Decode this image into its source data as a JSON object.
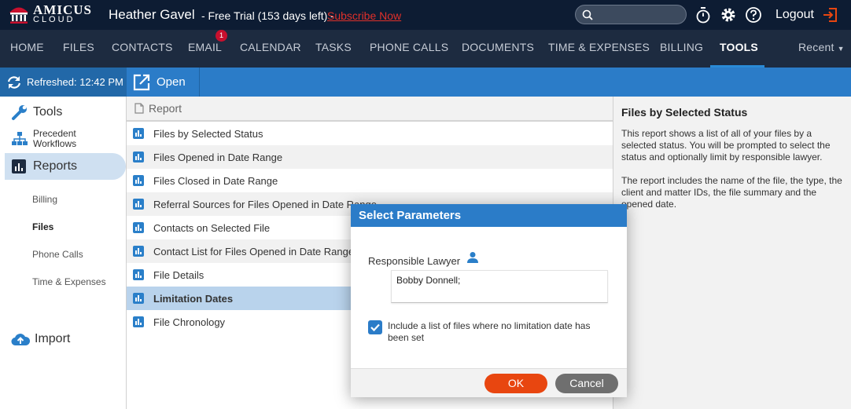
{
  "app": {
    "logo_line1": "AMICUS",
    "logo_line2": "CLOUD"
  },
  "header": {
    "user_name": "Heather Gavel",
    "trial": "- Free Trial (153 days left) -",
    "subscribe": "Subscribe Now",
    "logout": "Logout"
  },
  "nav": {
    "items": [
      "HOME",
      "FILES",
      "CONTACTS",
      "EMAIL",
      "CALENDAR",
      "TASKS",
      "PHONE CALLS",
      "DOCUMENTS",
      "TIME & EXPENSES",
      "BILLING",
      "TOOLS"
    ],
    "active": "TOOLS",
    "email_badge": "1",
    "recent": "Recent"
  },
  "toolbar": {
    "refreshed": "Refreshed: 12:42 PM",
    "open": "Open"
  },
  "sidebar": {
    "tools": "Tools",
    "workflows_line1": "Precedent",
    "workflows_line2": "Workflows",
    "reports": "Reports",
    "subs": [
      "Billing",
      "Files",
      "Phone Calls",
      "Time & Expenses"
    ],
    "selected_sub": "Files",
    "import": "Import"
  },
  "list": {
    "header": "Report",
    "rows": [
      "Files by Selected Status",
      "Files Opened in Date Range",
      "Files Closed in Date Range",
      "Referral Sources for Files Opened in Date Range",
      "Contacts on Selected File",
      "Contact List for Files Opened in Date Range",
      "File Details",
      "Limitation Dates",
      "File Chronology"
    ],
    "selected": "Limitation Dates"
  },
  "right_panel": {
    "title": "Files by Selected Status",
    "p1": "This report shows a list of all of your files by a selected status. You will be prompted to select the status and optionally limit by responsible lawyer.",
    "p2": "The report includes the name of the file, the type, the client and matter IDs, the file summary and the opened date."
  },
  "dialog": {
    "title": "Select Parameters",
    "lawyer_label": "Responsible Lawyer",
    "lawyer_value": "Bobby Donnell;",
    "checkbox_checked": true,
    "checkbox_label": "Include a list of files where no limitation date has been set",
    "ok": "OK",
    "cancel": "Cancel"
  },
  "colors": {
    "accent": "#2b7cc8",
    "ok": "#e84610",
    "topbar": "#0d1c33",
    "navbar": "#1d2b40",
    "subscribe": "#e0302a"
  }
}
